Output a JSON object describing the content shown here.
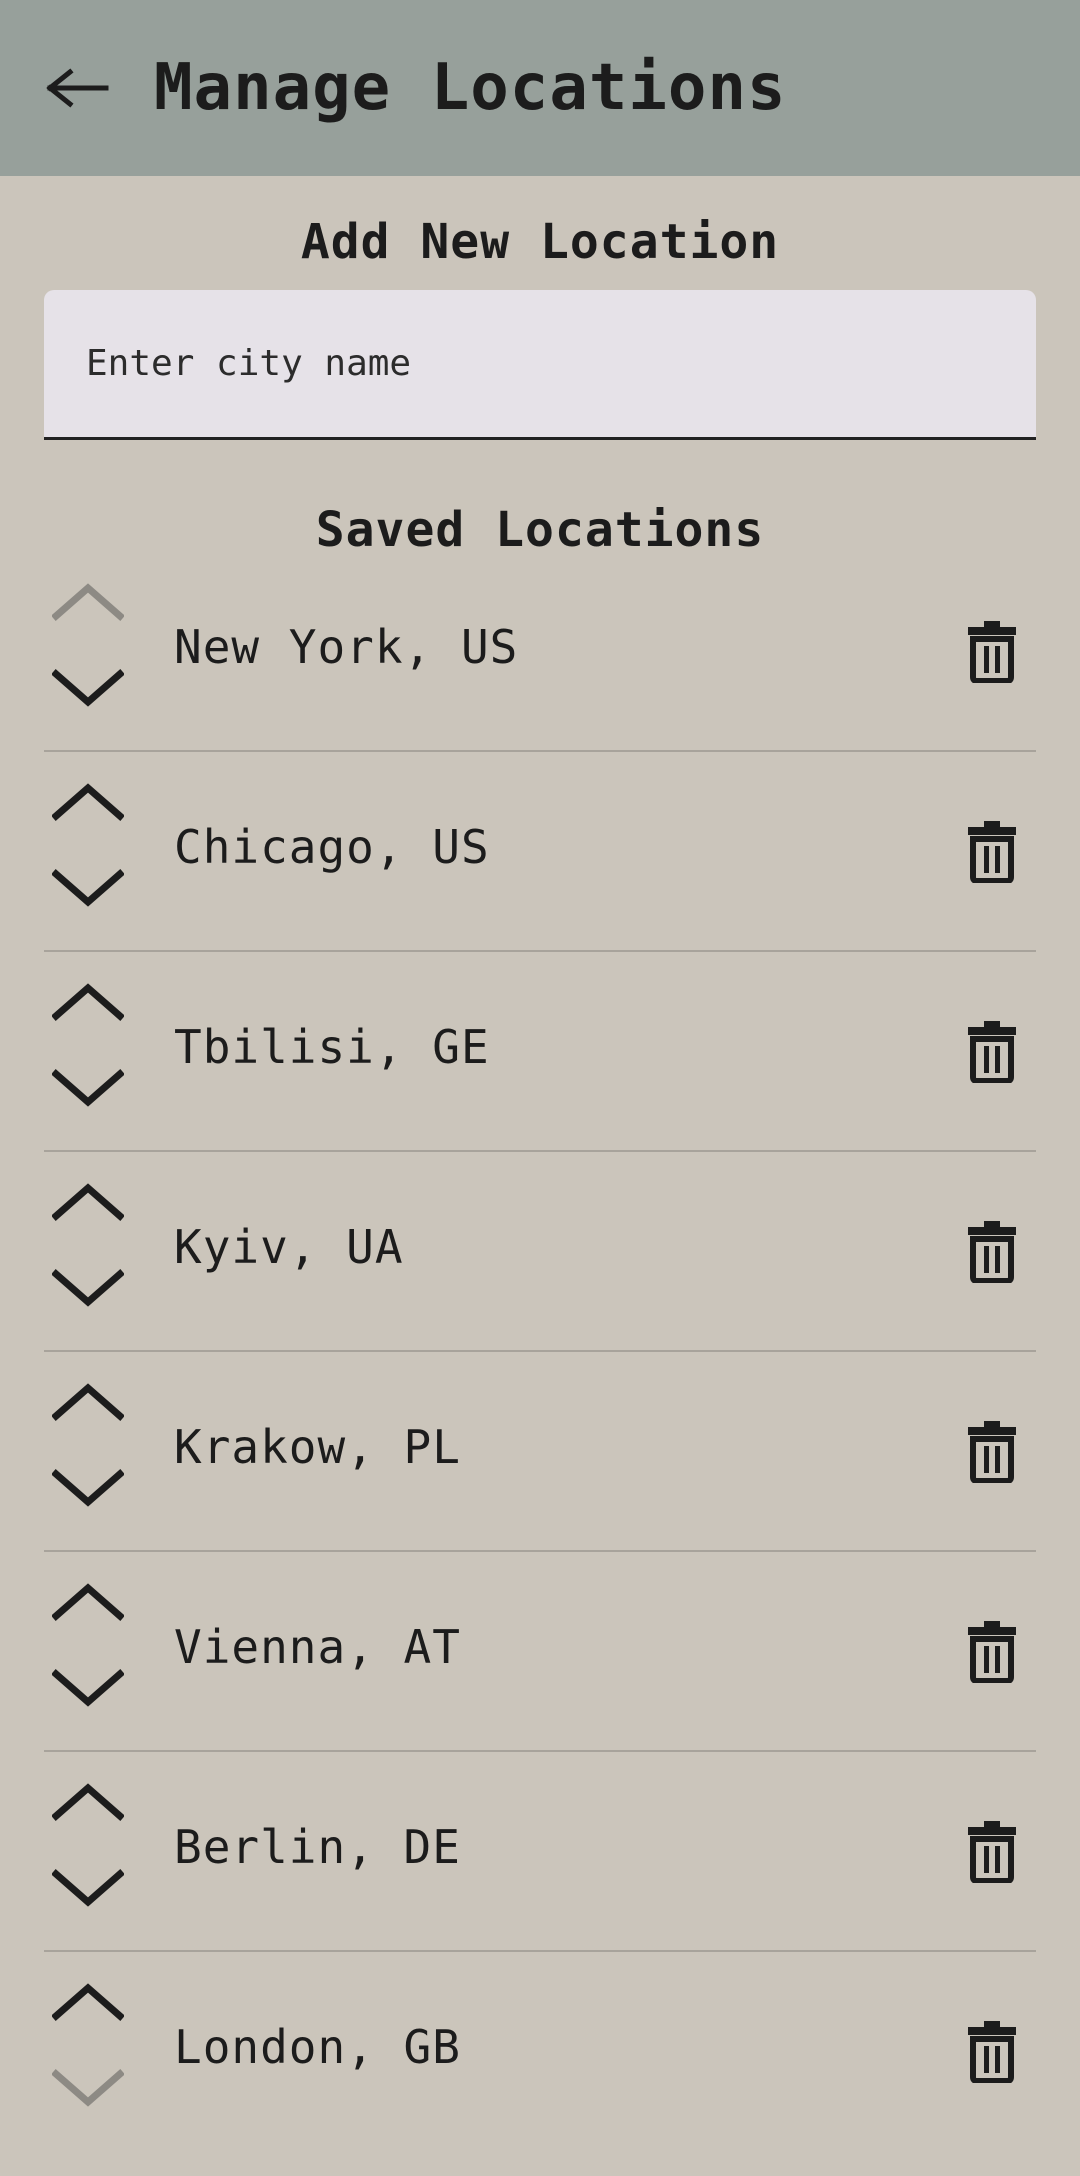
{
  "header": {
    "title": "Manage Locations",
    "back_icon": "arrow-left-icon",
    "background": "#97a09b"
  },
  "add_section": {
    "title": "Add New Location",
    "input_placeholder": "Enter city name",
    "input_value": ""
  },
  "saved_section": {
    "title": "Saved Locations",
    "locations": [
      {
        "name": "New York, US",
        "move_up_enabled": false,
        "move_down_enabled": true
      },
      {
        "name": "Chicago, US",
        "move_up_enabled": true,
        "move_down_enabled": true
      },
      {
        "name": "Tbilisi, GE",
        "move_up_enabled": true,
        "move_down_enabled": true
      },
      {
        "name": "Kyiv, UA",
        "move_up_enabled": true,
        "move_down_enabled": true
      },
      {
        "name": "Krakow, PL",
        "move_up_enabled": true,
        "move_down_enabled": true
      },
      {
        "name": "Vienna, AT",
        "move_up_enabled": true,
        "move_down_enabled": true
      },
      {
        "name": "Berlin, DE",
        "move_up_enabled": true,
        "move_down_enabled": true
      },
      {
        "name": "London, GB",
        "move_up_enabled": true,
        "move_down_enabled": false
      }
    ]
  },
  "colors": {
    "background": "#cbc5bb",
    "text": "#1c1c1c",
    "disabled_icon": "#8d8a84",
    "input_background": "#e6e2e8",
    "divider": "#a8a39b"
  }
}
